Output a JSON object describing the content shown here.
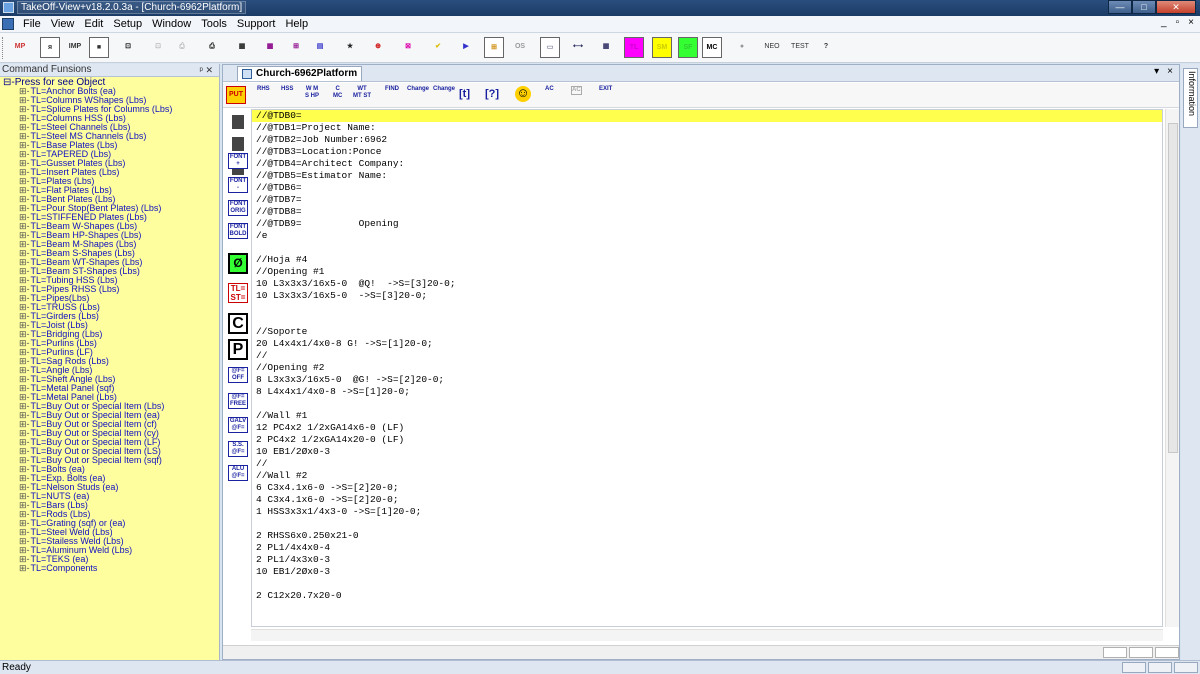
{
  "window": {
    "title": "TakeOff-View+v18.2.0.3a - [Church-6962Platform]",
    "buttons": {
      "minimize": "—",
      "maximize": "□",
      "close": "✕"
    }
  },
  "menubar": {
    "items": [
      "File",
      "View",
      "Edit",
      "Setup",
      "Window",
      "Tools",
      "Support",
      "Help"
    ],
    "mdi_controls": [
      "_",
      "▫",
      "×"
    ]
  },
  "toolbar": {
    "labels": [
      "MP",
      "ᴙ",
      "IMP",
      "■",
      "⊡",
      "⊡",
      "⎙",
      "⎙",
      "▦",
      "▦",
      "⊞",
      "▤",
      "★",
      "⊕",
      "⊠",
      "✔",
      "▶",
      "⊞",
      "OS",
      "▭",
      "⟷",
      "▦",
      "TL",
      "SM",
      "SF",
      "MC",
      "●",
      "NEO",
      "TEST",
      "?"
    ]
  },
  "left_pane": {
    "title": "Command Funsions",
    "pin_controls": "ᵖ ✕",
    "root": "Press for see Object",
    "items": [
      "TL=Anchor Bolts (ea)",
      "TL=Columns WShapes (Lbs)",
      "TL=Splice Plates for Columns (Lbs)",
      "TL=Columns HSS (Lbs)",
      "TL=Steel Channels (Lbs)",
      "TL=Steel MS Channels (Lbs)",
      "TL=Base Plates (Lbs)",
      "TL=TAPERED (Lbs)",
      "TL=Gusset Plates (Lbs)",
      "TL=Insert Plates (Lbs)",
      "TL=Plates (Lbs)",
      "TL=Flat Plates (Lbs)",
      "TL=Bent Plates (Lbs)",
      "TL=Pour Stop(Bent Plates) (Lbs)",
      "TL=STIFFENED Plates (Lbs)",
      "TL=Beam W-Shapes (Lbs)",
      "TL=Beam HP-Shapes (Lbs)",
      "TL=Beam M-Shapes (Lbs)",
      "TL=Beam S-Shapes (Lbs)",
      "TL=Beam WT-Shapes (Lbs)",
      "TL=Beam ST-Shapes (Lbs)",
      "TL=Tubing HSS (Lbs)",
      "TL=Pipes RHSS (Lbs)",
      "TL=Pipes(Lbs)",
      "TL=TRUSS (Lbs)",
      "TL=Girders (Lbs)",
      "TL=Joist (Lbs)",
      "TL=Bridging (Lbs)",
      "TL=Purlins (Lbs)",
      "TL=Purlins (LF)",
      "TL=Sag Rods (Lbs)",
      "TL=Angle (Lbs)",
      "TL=Sheft Angle (Lbs)",
      "TL=Metal Panel (sqf)",
      "TL=Metal Panel (Lbs)",
      "TL=Buy Out or Special Item (Lbs)",
      "TL=Buy Out or Special Item (ea)",
      "TL=Buy Out or Special Item (cf)",
      "TL=Buy Out or Special Item (cy)",
      "TL=Buy Out or Special Item (LF)",
      "TL=Buy Out or Special Item (LS)",
      "TL=Buy Out or Special Item (sqf)",
      "TL=Bolts (ea)",
      "TL=Exp. Bolts (ea)",
      "TL=Nelson Studs (ea)",
      "TL=NUTS (ea)",
      "TL=Bars (Lbs)",
      "TL=Rods (Lbs)",
      "TL=Grating (sqf) or (ea)",
      "TL=Steel Weld (Lbs)",
      "TL=Stailess Weld (Lbs)",
      "TL=Aluminum Weld (Lbs)",
      "TL=TEKS (ea)",
      "TL=Components"
    ]
  },
  "document": {
    "tab_title": "Church-6962Platform",
    "tab_controls": [
      "▾",
      "×"
    ],
    "inner_toolbar": [
      "PUT",
      "RHS",
      "HSS",
      "W M\nS HP",
      "C\nMC",
      "WT\nMT ST",
      "FIND",
      "Change",
      "Change",
      "[t]",
      "[?]",
      "☺",
      "AC",
      "AC",
      "EXIT"
    ],
    "side_tools": [
      "FONT\n+",
      "FONT\n-",
      "FONT\nORIG",
      "FONT\nBOLD",
      "Ø",
      "TL=\nST=",
      "C",
      "P",
      "@F=\nOFF",
      "@F=\nFREE",
      "GALV\n@F=",
      "S.S.\n@F=",
      "ALU\n@F="
    ],
    "lines": [
      "//@TDB0=",
      "//@TDB1=Project Name:",
      "//@TDB2=Job Number:6962",
      "//@TDB3=Location:Ponce",
      "//@TDB4=Architect Company:",
      "//@TDB5=Estimator Name:",
      "//@TDB6=",
      "//@TDB7=",
      "//@TDB8=",
      "//@TDB9=          Opening",
      "/e",
      "",
      "//Hoja #4",
      "//Opening #1",
      "10 L3x3x3/16x5-0  @Q!  ->S=[3]20-0;",
      "10 L3x3x3/16x5-0  ->S=[3]20-0;",
      "",
      "",
      "//Soporte",
      "20 L4x4x1/4x0-8 G! ->S=[1]20-0;",
      "//",
      "//Opening #2",
      "8 L3x3x3/16x5-0  @G! ->S=[2]20-0;",
      "8 L4x4x1/4x0-8 ->S=[1]20-0;",
      "",
      "//Wall #1",
      "12 PC4x2 1/2xGA14x6-0 (LF)",
      "2 PC4x2 1/2xGA14x20-0 (LF)",
      "10 EB1/2Øx0-3",
      "//",
      "//Wall #2",
      "6 C3x4.1x6-0 ->S=[2]20-0;",
      "4 C3x4.1x6-0 ->S=[2]20-0;",
      "1 HSS3x3x1/4x3-0 ->S=[1]20-0;",
      "",
      "2 RHSS6x0.250x21-0",
      "2 PL1/4x4x0-4",
      "2 PL1/4x3x0-3",
      "10 EB1/2Øx0-3",
      "",
      "2 C12x20.7x20-0"
    ]
  },
  "right_strip": {
    "tab_label": "Information"
  },
  "statusbar": {
    "text": "Ready"
  },
  "colors": {
    "tree_bg": "#fefe9f",
    "highlight_line": "#ffff4d",
    "title_bg": "#1b3b66"
  }
}
